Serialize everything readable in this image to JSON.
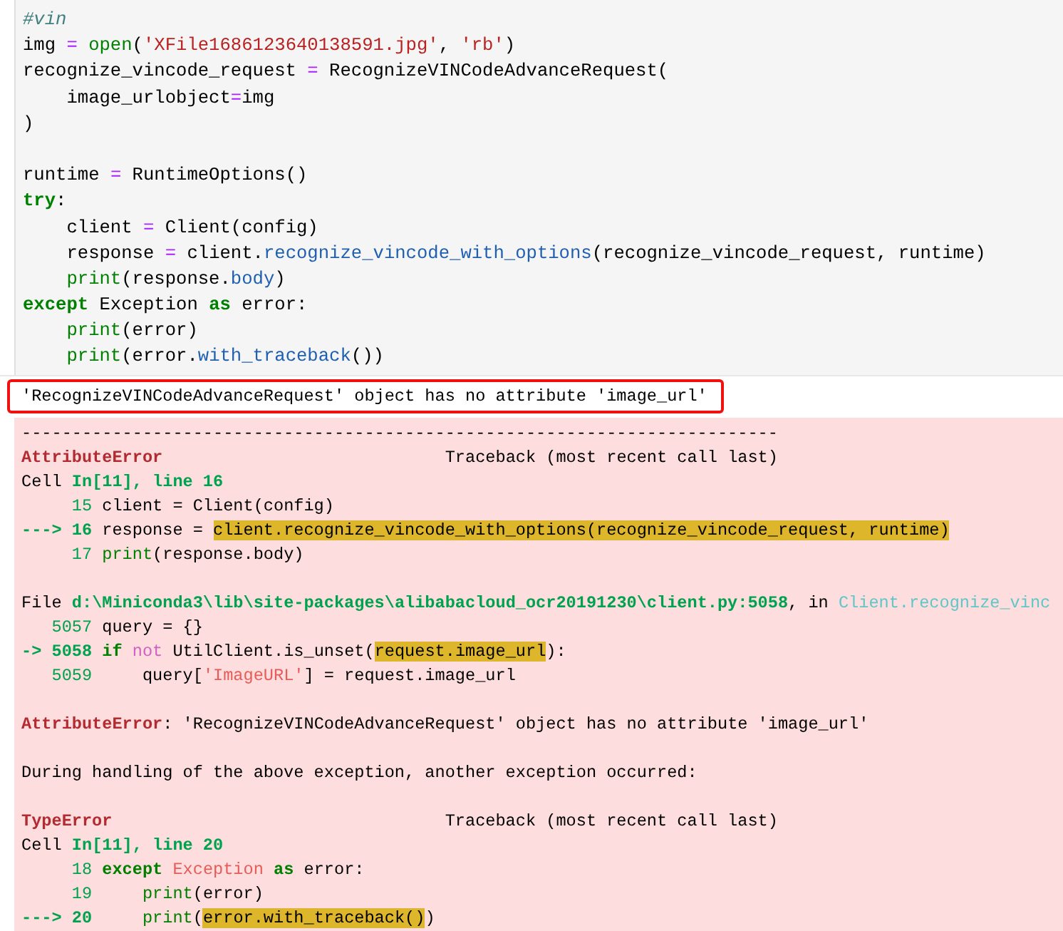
{
  "input_cell": {
    "blocks": [
      {
        "lines": [
          [
            {
              "kind": "comment",
              "text": "#vin"
            }
          ],
          [
            {
              "kind": "plain",
              "text": "img "
            },
            {
              "kind": "op",
              "text": "= "
            },
            {
              "kind": "builtin",
              "text": "open"
            },
            {
              "kind": "plain",
              "text": "("
            },
            {
              "kind": "str",
              "text": "'XFile1686123640138591.jpg'"
            },
            {
              "kind": "plain",
              "text": ", "
            },
            {
              "kind": "str",
              "text": "'rb'"
            },
            {
              "kind": "plain",
              "text": ")"
            }
          ],
          [
            {
              "kind": "plain",
              "text": "recognize_vincode_request "
            },
            {
              "kind": "op",
              "text": "="
            },
            {
              "kind": "plain",
              "text": " RecognizeVINCodeAdvanceRequest("
            }
          ],
          [
            {
              "kind": "plain",
              "text": "    image_urlobject"
            },
            {
              "kind": "op",
              "text": "="
            },
            {
              "kind": "plain",
              "text": "img"
            }
          ],
          [
            {
              "kind": "plain",
              "text": ")"
            }
          ]
        ]
      },
      {
        "lines": [
          [
            {
              "kind": "plain",
              "text": "runtime "
            },
            {
              "kind": "op",
              "text": "="
            },
            {
              "kind": "plain",
              "text": " RuntimeOptions()"
            }
          ],
          [
            {
              "kind": "kw",
              "text": "try"
            },
            {
              "kind": "plain",
              "text": ":"
            }
          ],
          [
            {
              "kind": "plain",
              "text": "    client "
            },
            {
              "kind": "op",
              "text": "="
            },
            {
              "kind": "plain",
              "text": " Client(config)"
            }
          ],
          [
            {
              "kind": "plain",
              "text": "    response "
            },
            {
              "kind": "op",
              "text": "="
            },
            {
              "kind": "plain",
              "text": " client."
            },
            {
              "kind": "attr",
              "text": "recognize_vincode_with_options"
            },
            {
              "kind": "plain",
              "text": "(recognize_vincode_request, runtime)"
            }
          ],
          [
            {
              "kind": "builtin",
              "text": "    print"
            },
            {
              "kind": "plain",
              "text": "(response."
            },
            {
              "kind": "attr",
              "text": "body"
            },
            {
              "kind": "plain",
              "text": ")"
            }
          ],
          [
            {
              "kind": "kw",
              "text": "except"
            },
            {
              "kind": "plain",
              "text": " Exception "
            },
            {
              "kind": "kw",
              "text": "as"
            },
            {
              "kind": "plain",
              "text": " error:"
            }
          ],
          [
            {
              "kind": "builtin",
              "text": "    print"
            },
            {
              "kind": "plain",
              "text": "(error)"
            }
          ],
          [
            {
              "kind": "builtin",
              "text": "    print"
            },
            {
              "kind": "plain",
              "text": "(error."
            },
            {
              "kind": "attr",
              "text": "with_traceback"
            },
            {
              "kind": "plain",
              "text": "())"
            }
          ]
        ]
      }
    ]
  },
  "output": {
    "text": "'RecognizeVINCodeAdvanceRequest' object has no attribute 'image_url'",
    "annotated": true
  },
  "traceback": {
    "blocks": [
      {
        "lines": [
          [
            {
              "kind": "plain",
              "text": "---------------------------------------------------------------------------"
            }
          ],
          [
            {
              "kind": "err",
              "text": "AttributeError"
            },
            {
              "kind": "plain",
              "text": "                            Traceback (most recent call last)"
            }
          ],
          [
            {
              "kind": "plain",
              "text": "Cell "
            },
            {
              "kind": "loc",
              "text": "In[11], line 16"
            }
          ],
          [
            {
              "kind": "lineno",
              "text": "     15"
            },
            {
              "kind": "plain",
              "text": " client = Client(config)"
            }
          ],
          [
            {
              "kind": "arrow",
              "text": "---> 16"
            },
            {
              "kind": "plain",
              "text": " response = "
            },
            {
              "kind": "hl",
              "text": "client.recognize_vincode_with_options(recognize_vincode_request, runtime)"
            }
          ],
          [
            {
              "kind": "lineno",
              "text": "     17"
            },
            {
              "kind": "builtin",
              "text": " print"
            },
            {
              "kind": "plain",
              "text": "(response.body)"
            }
          ]
        ]
      },
      {
        "lines": [
          [
            {
              "kind": "plain",
              "text": "File "
            },
            {
              "kind": "loc",
              "text": "d:\\Miniconda3\\lib\\site-packages\\alibabacloud_ocr20191230\\client.py:5058"
            },
            {
              "kind": "plain",
              "text": ", in "
            },
            {
              "kind": "cyan",
              "text": "Client.recognize_vinc"
            }
          ],
          [
            {
              "kind": "lineno",
              "text": "   5057"
            },
            {
              "kind": "plain",
              "text": " query = {}"
            }
          ],
          [
            {
              "kind": "arrow",
              "text": "-> 5058"
            },
            {
              "kind": "kw",
              "text": " if"
            },
            {
              "kind": "magenta",
              "text": " not"
            },
            {
              "kind": "plain",
              "text": " UtilClient.is_unset("
            },
            {
              "kind": "hl",
              "text": "request.image_url"
            },
            {
              "kind": "plain",
              "text": "):"
            }
          ],
          [
            {
              "kind": "lineno",
              "text": "   5059"
            },
            {
              "kind": "plain",
              "text": "     query["
            },
            {
              "kind": "exc",
              "text": "'ImageURL'"
            },
            {
              "kind": "plain",
              "text": "] = request.image_url"
            }
          ]
        ]
      },
      {
        "lines": [
          [
            {
              "kind": "err",
              "text": "AttributeError"
            },
            {
              "kind": "plain",
              "text": ": 'RecognizeVINCodeAdvanceRequest' object has no attribute 'image_url'"
            }
          ]
        ]
      },
      {
        "lines": [
          [
            {
              "kind": "plain",
              "text": "During handling of the above exception, another exception occurred:"
            }
          ]
        ]
      },
      {
        "lines": [
          [
            {
              "kind": "err",
              "text": "TypeError"
            },
            {
              "kind": "plain",
              "text": "                                 Traceback (most recent call last)"
            }
          ],
          [
            {
              "kind": "plain",
              "text": "Cell "
            },
            {
              "kind": "loc",
              "text": "In[11], line 20"
            }
          ],
          [
            {
              "kind": "lineno",
              "text": "     18"
            },
            {
              "kind": "kw",
              "text": " except"
            },
            {
              "kind": "exc",
              "text": " Exception"
            },
            {
              "kind": "kw",
              "text": " as"
            },
            {
              "kind": "plain",
              "text": " error:"
            }
          ],
          [
            {
              "kind": "lineno",
              "text": "     19"
            },
            {
              "kind": "builtin",
              "text": "     print"
            },
            {
              "kind": "plain",
              "text": "(error)"
            }
          ],
          [
            {
              "kind": "arrow",
              "text": "---> 20"
            },
            {
              "kind": "builtin",
              "text": "     print"
            },
            {
              "kind": "plain",
              "text": "("
            },
            {
              "kind": "hl",
              "text": "error.with_traceback()"
            },
            {
              "kind": "plain",
              "text": ")"
            }
          ]
        ]
      }
    ]
  }
}
